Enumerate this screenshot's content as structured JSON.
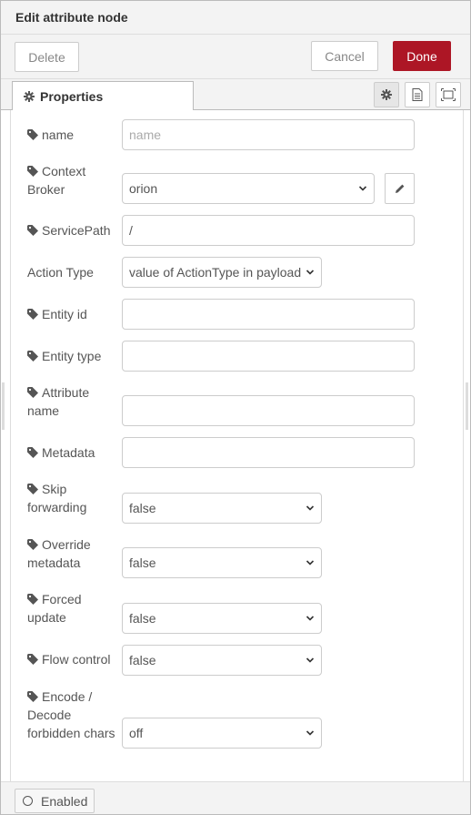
{
  "header": {
    "title": "Edit attribute node"
  },
  "toolbar": {
    "delete_label": "Delete",
    "cancel_label": "Cancel",
    "done_label": "Done"
  },
  "tabs": {
    "properties_label": "Properties"
  },
  "tab_icons": [
    "gear-icon",
    "description-icon",
    "appearance-icon"
  ],
  "form": {
    "name": {
      "label": "name",
      "value": "",
      "placeholder": "name"
    },
    "context_broker": {
      "label_line1": "Context",
      "label_line2": "Broker",
      "value": "orion"
    },
    "service_path": {
      "label": "ServicePath",
      "value": "/"
    },
    "action_type": {
      "label": "Action Type",
      "value": "value of ActionType in payload"
    },
    "entity_id": {
      "label": "Entity id",
      "value": ""
    },
    "entity_type": {
      "label": "Entity type",
      "value": ""
    },
    "attribute_name": {
      "label_line1": "Attribute",
      "label_line2": "name",
      "value": ""
    },
    "metadata": {
      "label": "Metadata",
      "value": ""
    },
    "skip_forwarding": {
      "label_line1": "Skip",
      "label_line2": "forwarding",
      "value": "false"
    },
    "override_metadata": {
      "label_line1": "Override",
      "label_line2": "metadata",
      "value": "false"
    },
    "forced_update": {
      "label_line1": "Forced",
      "label_line2": "update",
      "value": "false"
    },
    "flow_control": {
      "label": "Flow control",
      "value": "false"
    },
    "encode_decode": {
      "label_line1": "Encode /",
      "label_line2": "Decode",
      "label_line3": "forbidden chars",
      "value": "off"
    }
  },
  "footer": {
    "enabled_label": "Enabled"
  },
  "colors": {
    "primary": "#ad1625",
    "border": "#cccccc",
    "panel": "#f3f3f3"
  }
}
